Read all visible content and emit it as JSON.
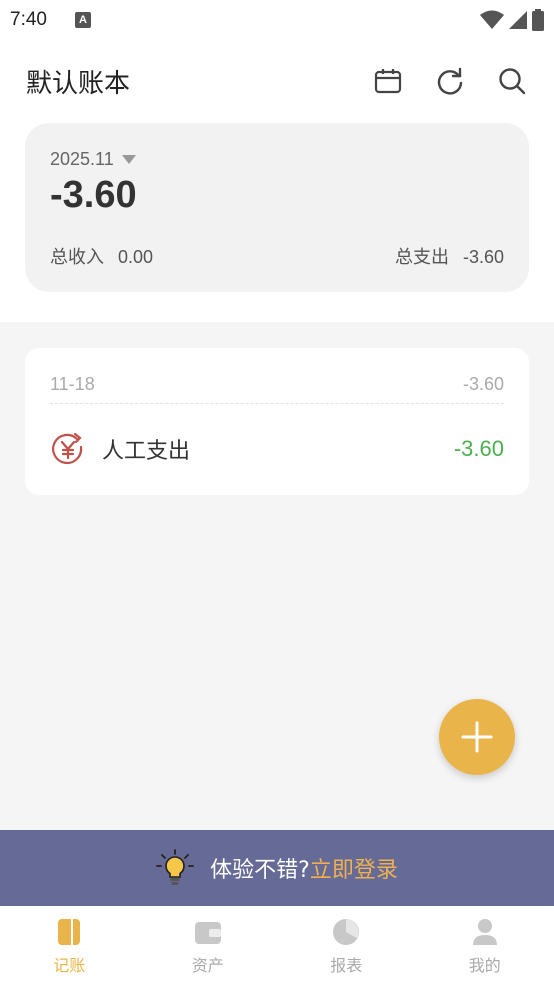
{
  "status_bar": {
    "time": "7:40",
    "notification_glyph": "A"
  },
  "header": {
    "title": "默认账本"
  },
  "summary": {
    "month": "2025.11",
    "balance": "-3.60",
    "income_label": "总收入",
    "income_value": "0.00",
    "expense_label": "总支出",
    "expense_value": "-3.60"
  },
  "day_groups": [
    {
      "date": "11-18",
      "total": "-3.60",
      "entries": [
        {
          "category": "人工支出",
          "amount": "-3.60",
          "icon": "yuan-refund-icon"
        }
      ]
    }
  ],
  "login_banner": {
    "prompt": "体验不错?",
    "link": "立即登录"
  },
  "tabs": [
    {
      "label": "记账",
      "icon": "ledger-icon",
      "active": true
    },
    {
      "label": "资产",
      "icon": "wallet-icon",
      "active": false
    },
    {
      "label": "报表",
      "icon": "pie-chart-icon",
      "active": false
    },
    {
      "label": "我的",
      "icon": "user-icon",
      "active": false
    }
  ],
  "colors": {
    "accent": "#e9b54a",
    "income_green": "#4caf50",
    "banner": "#666a96",
    "category_red": "#c0504a"
  }
}
